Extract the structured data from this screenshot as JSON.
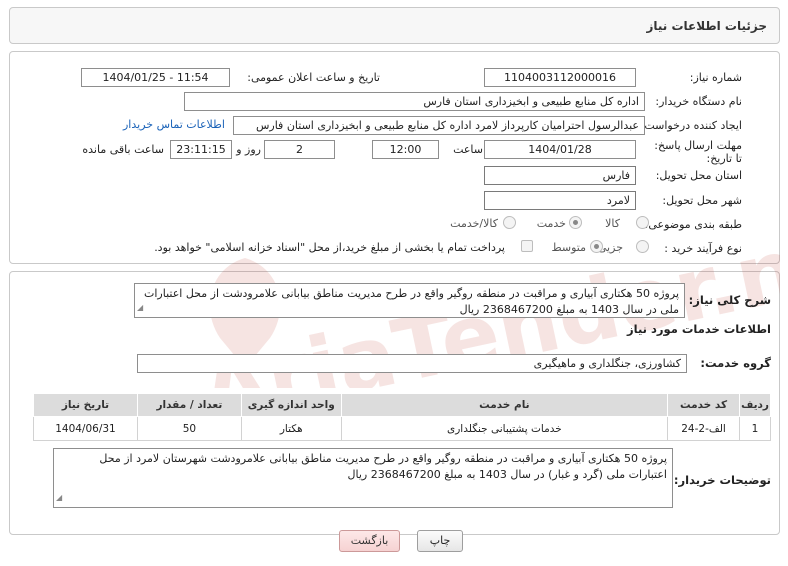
{
  "header": {
    "title": "جزئیات اطلاعات نیاز"
  },
  "form": {
    "need_number_label": "شماره نیاز:",
    "need_number": "1104003112000016",
    "announce_label": "تاریخ و ساعت اعلان عمومی:",
    "announce_value": "1404/01/25 - 11:54",
    "buyer_label": "نام دستگاه خریدار:",
    "buyer_value": "اداره کل منابع طبیعی و ابخیزداری استان فارس",
    "requester_label": "ایجاد کننده درخواست:",
    "requester_value": "عبدالرسول احترامیان کارپرداز لامرد اداره کل منابع طبیعی و ابخیزداری استان فارس",
    "contact_link": "اطلاعات تماس خریدار",
    "deadline_label": "مهلت ارسال پاسخ: تا تاریخ:",
    "deadline_date": "1404/01/28",
    "time_label": "ساعت",
    "deadline_time": "12:00",
    "days_value": "2",
    "days_label": "روز و",
    "remaining_time": "23:11:15",
    "remaining_label": "ساعت باقی مانده",
    "province_label": "استان محل تحویل:",
    "province_value": "فارس",
    "city_label": "شهر محل تحویل:",
    "city_value": "لامرد",
    "category_label": "طبقه بندی موضوعی:",
    "category_options": [
      "کالا",
      "خدمت",
      "کالا/خدمت"
    ],
    "category_selected": "خدمت",
    "process_label": "نوع فرآیند خرید :",
    "process_options": [
      "جزیی",
      "متوسط"
    ],
    "process_selected": "متوسط",
    "payment_note": "پرداخت تمام یا بخشی از مبلغ خرید،از محل \"اسناد خزانه اسلامی\" خواهد بود."
  },
  "details": {
    "summary_label": "شرح کلی نیاز:",
    "summary_text": "پروژه 50 هکتاری آبیاری و مراقبت در منطقه روگیر واقع در طرح مدیریت مناطق بیابانی علامرودشت از محل اعتبارات ملی  در سال 1403 به مبلغ 2368467200 ریال",
    "services_heading": "اطلاعات خدمات مورد نیاز",
    "service_group_label": "گروه خدمت:",
    "service_group_value": "کشاورزی، جنگلداری و ماهیگیری",
    "table": {
      "headers": [
        "ردیف",
        "کد خدمت",
        "نام خدمت",
        "واحد اندازه گیری",
        "تعداد / مقدار",
        "تاریخ نیاز"
      ],
      "rows": [
        [
          "1",
          "الف-2-24",
          "خدمات پشتیبانی جنگلداری",
          "هکتار",
          "50",
          "1404/06/31"
        ]
      ]
    },
    "buyer_notes_label": "توضیحات خریدار:",
    "buyer_notes_text": "پروژه 50 هکتاری آبیاری و مراقبت در منطقه روگیر واقع در طرح مدیریت مناطق بیابانی علامرودشت شهرستان لامرد از محل اعتبارات ملی (گرد و غبار) در سال 1403 به مبلغ 2368467200 ریال"
  },
  "buttons": {
    "print": "چاپ",
    "back": "بازگشت"
  },
  "watermark": {
    "text": "AriaTender.net"
  },
  "colors": {
    "link": "#1a62b8",
    "back_button": "#f6d2d2",
    "watermark": "#c0392b"
  }
}
